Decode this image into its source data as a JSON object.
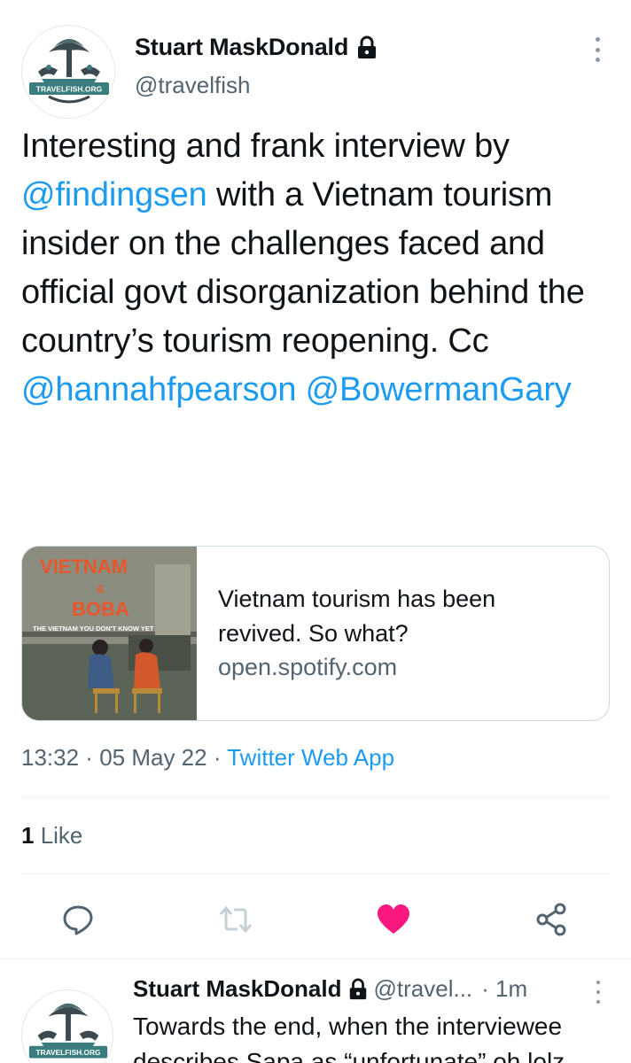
{
  "tweet": {
    "display_name": "Stuart MaskDonald",
    "handle": "@travelfish",
    "avatar_label": "TRAVELFISH.ORG",
    "text_parts": [
      {
        "t": "Interesting and frank interview by ",
        "mention": false
      },
      {
        "t": "@findingsen",
        "mention": true
      },
      {
        "t": " with a Vietnam tourism insider on the challenges faced and official govt disorganization behind the country’s tourism reopening. Cc ",
        "mention": false
      },
      {
        "t": "@hannahfpearson",
        "mention": true
      },
      {
        "t": " ",
        "mention": false
      },
      {
        "t": "@BowermanGary",
        "mention": true
      }
    ]
  },
  "card": {
    "image_title_line1": "VIETNAM",
    "image_title_amp": "&",
    "image_title_line2": "BOBA",
    "image_subtitle": "THE VIETNAM YOU DON'T KNOW YET",
    "title": "Vietnam tourism has been revived. So what?",
    "domain": "open.spotify.com"
  },
  "meta": {
    "time": "13:32",
    "sep1": " · ",
    "date": "05 May 22",
    "sep2": " · ",
    "app": "Twitter Web App"
  },
  "stats": {
    "like_count": "1",
    "like_label": " Like"
  },
  "actions": {
    "icons": [
      "reply-icon",
      "retweet-icon",
      "like-icon",
      "share-icon"
    ],
    "like_color": "#f91880",
    "retweet_color": "#c4cfd6",
    "default_color": "#536471"
  },
  "reply": {
    "display_name": "Stuart MaskDonald",
    "handle": "@travel...",
    "sep": " · ",
    "time": "1m",
    "avatar_label": "TRAVELFISH.ORG",
    "text_line1": "Towards the end, when the interviewee",
    "text_line2": "describes Sapa as “unfortunate” oh lolz"
  },
  "colors": {
    "accent": "#1d9bf0",
    "secondary_text": "#536471",
    "primary_text": "#0f1419",
    "border": "#cfd9de",
    "logo_teal": "#3a7d7e"
  }
}
